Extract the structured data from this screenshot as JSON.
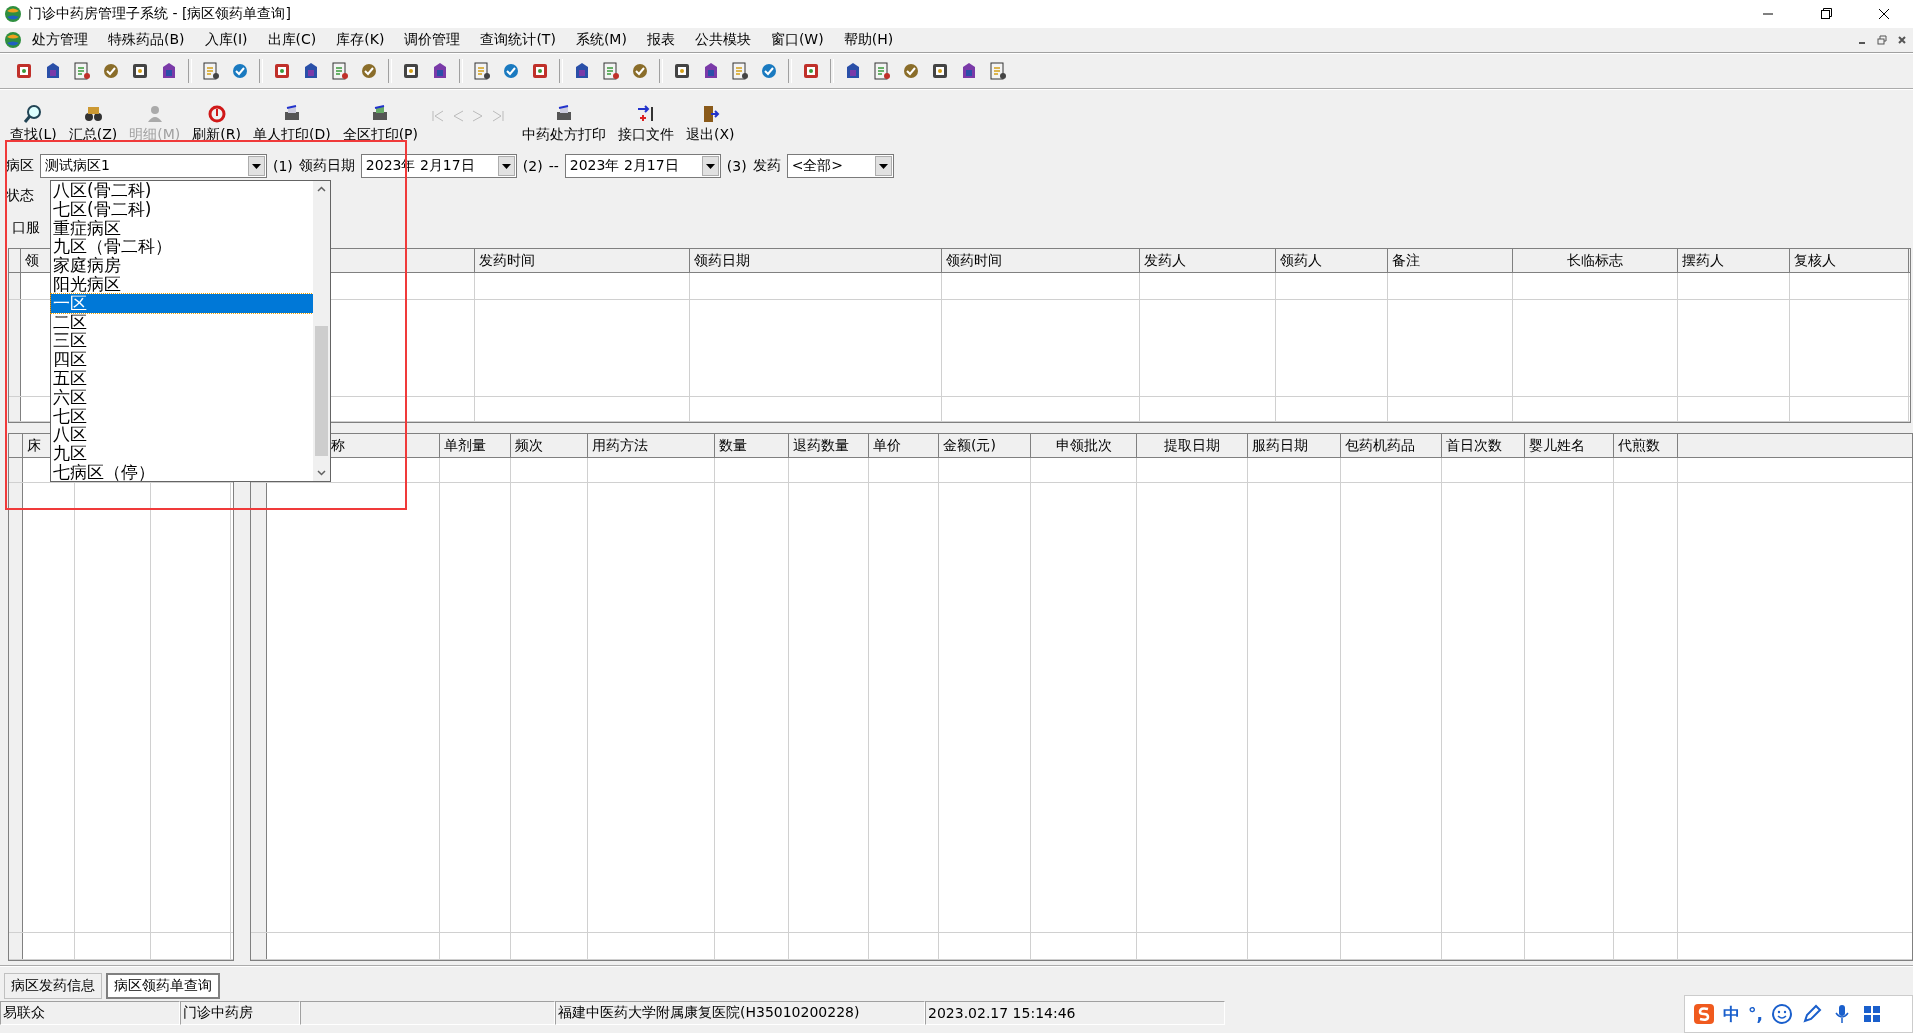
{
  "window": {
    "title": "门诊中药房管理子系统 - [病区领药单查询]"
  },
  "menu": [
    "处方管理",
    "特殊药品(B)",
    "入库(I)",
    "出库(C)",
    "库存(K)",
    "调价管理",
    "查询统计(T)",
    "系统(M)",
    "报表",
    "公共模块",
    "窗口(W)",
    "帮助(H)"
  ],
  "toolbar": [
    {
      "label": "查找(L)",
      "disabled": false
    },
    {
      "label": "汇总(Z)",
      "disabled": false
    },
    {
      "label": "明细(M)",
      "disabled": true
    },
    {
      "label": "刷新(R)",
      "disabled": false
    },
    {
      "label": "单人打印(D)",
      "disabled": false
    },
    {
      "label": "全区打印(P)",
      "disabled": false
    },
    {
      "label": "中药处方打印",
      "disabled": false
    },
    {
      "label": "接口文件",
      "disabled": false
    },
    {
      "label": "退出(X)",
      "disabled": false
    }
  ],
  "filter": {
    "ward_label": "病区",
    "ward_value": "测试病区1",
    "step1": "(1)",
    "date_label": "领药日期",
    "date_from": "2023年 2月17日",
    "step2": "(2)",
    "dash": "--",
    "date_to": "2023年 2月17日",
    "step3": "(3)",
    "dispense_label": "发药",
    "dispense_value": "<全部>"
  },
  "state_label": "状态",
  "oral_label": "口服",
  "ward_dropdown": {
    "items": [
      {
        "label": "八区(骨二科)",
        "selected": false
      },
      {
        "label": "七区(骨二科)",
        "selected": false
      },
      {
        "label": "重症病区",
        "selected": false
      },
      {
        "label": "九区（骨二科）",
        "selected": false
      },
      {
        "label": "家庭病房",
        "selected": false
      },
      {
        "label": "阳光病区",
        "selected": false
      },
      {
        "label": "一区",
        "selected": true
      },
      {
        "label": "二区",
        "selected": false
      },
      {
        "label": "三区",
        "selected": false
      },
      {
        "label": "四区",
        "selected": false
      },
      {
        "label": "五区",
        "selected": false
      },
      {
        "label": "六区",
        "selected": false
      },
      {
        "label": "七区",
        "selected": false
      },
      {
        "label": "八区",
        "selected": false
      },
      {
        "label": "九区",
        "selected": false
      },
      {
        "label": "七病区（停）",
        "selected": false
      }
    ]
  },
  "upper_table": {
    "columns": [
      "领",
      "发药时间",
      "领药日期",
      "领药时间",
      "发药人",
      "领药人",
      "备注",
      "长临标志",
      "摆药人",
      "复核人"
    ]
  },
  "lower_left_table": {
    "columns": [
      "床"
    ]
  },
  "lower_table": {
    "columns": [
      "称",
      "单剂量",
      "频次",
      "用药方法",
      "数量",
      "退药数量",
      "单价",
      "金额(元)",
      "申领批次",
      "提取日期",
      "服药日期",
      "包药机药品",
      "首日次数",
      "婴儿姓名",
      "代煎数"
    ]
  },
  "tabs": [
    {
      "label": "病区发药信息",
      "selected": false
    },
    {
      "label": "病区领药单查询",
      "selected": true
    }
  ],
  "status_bar": [
    "易联众",
    "门诊中药房",
    "福建中医药大学附属康复医院(H35010200228)",
    "2023.02.17 15:14:46"
  ],
  "ime": {
    "mode": "中",
    "punct": "°,"
  }
}
